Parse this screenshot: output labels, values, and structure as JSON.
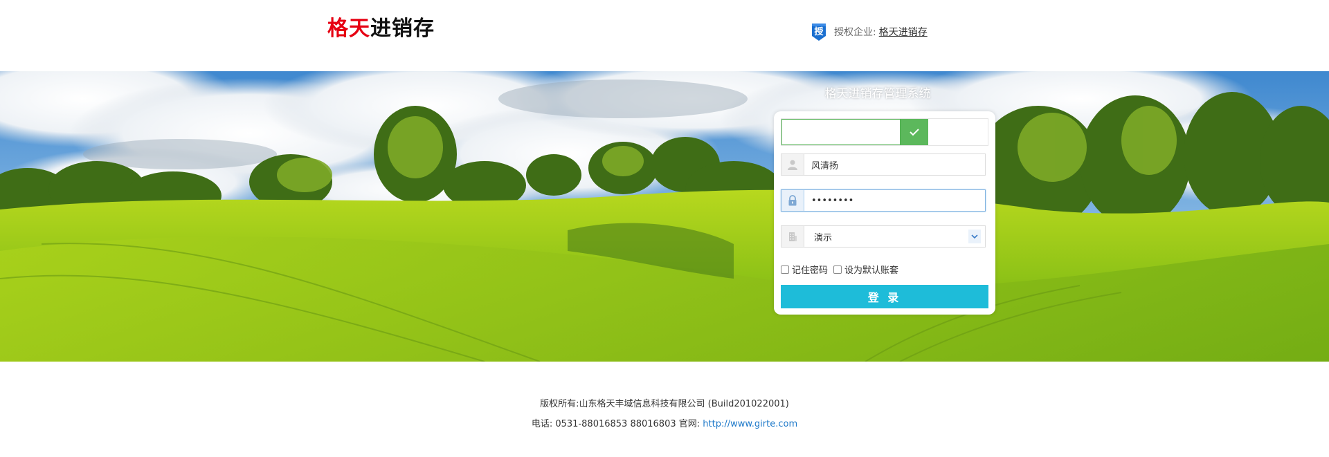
{
  "header": {
    "logo_red": "格天",
    "logo_black": "进销存",
    "auth_badge": "授",
    "auth_label": "授权企业:",
    "auth_company": "格天进销存"
  },
  "login": {
    "system_title": "格天进销存管理系统",
    "username_value": "风清扬",
    "password_value": "••••••••",
    "account_set": "演示",
    "remember_password": "记住密码",
    "set_default_account": "设为默认账套",
    "login_button": "登 录"
  },
  "footer": {
    "copyright": "版权所有:山东格天丰域信息科技有限公司 (Build201022001)",
    "phone": "电话: 0531-88016853 88016803 官网: ",
    "website": "http://www.girte.com"
  },
  "colors": {
    "logo_red": "#e60012",
    "login_button": "#1ebcd9",
    "slider_green": "#5cb85c",
    "link_blue": "#1c78c9"
  },
  "icons": {
    "auth": "shield-badge-icon",
    "slider": "check-icon",
    "username": "user-icon",
    "password": "lock-icon",
    "account": "building-icon",
    "select": "chevron-down-icon"
  }
}
